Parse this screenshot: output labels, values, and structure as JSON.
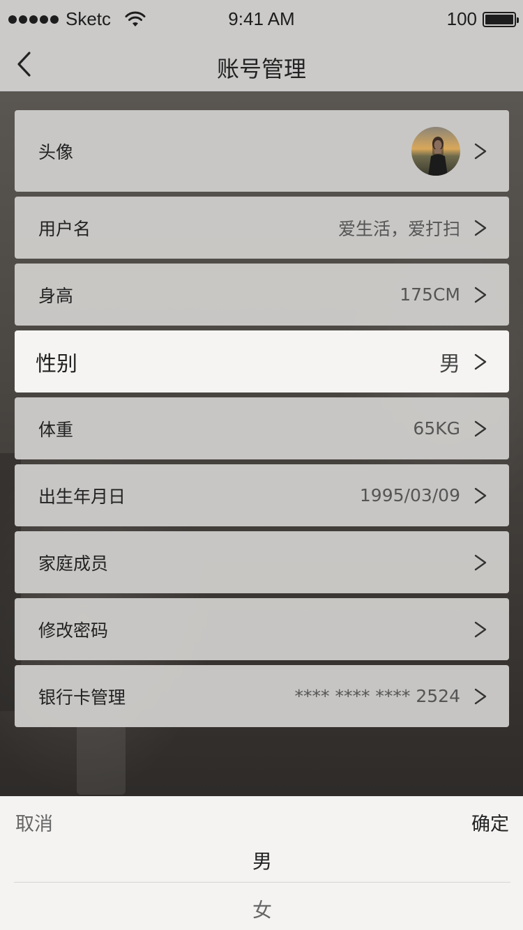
{
  "status_bar": {
    "carrier": "Sketc",
    "time": "9:41 AM",
    "battery": "100"
  },
  "nav": {
    "title": "账号管理"
  },
  "rows": [
    {
      "label": "头像",
      "value": ""
    },
    {
      "label": "用户名",
      "value": "爱生活，爱打扫"
    },
    {
      "label": "身高",
      "value": "175CM"
    },
    {
      "label": "性别",
      "value": "男"
    },
    {
      "label": "体重",
      "value": "65KG"
    },
    {
      "label": "出生年月日",
      "value": "1995/03/09"
    },
    {
      "label": "家庭成员",
      "value": ""
    },
    {
      "label": "修改密码",
      "value": ""
    },
    {
      "label": "银行卡管理",
      "value": "**** **** **** 2524"
    }
  ],
  "chevron": ">",
  "picker": {
    "cancel": "取消",
    "confirm": "确定",
    "options": [
      "男",
      "女"
    ]
  }
}
